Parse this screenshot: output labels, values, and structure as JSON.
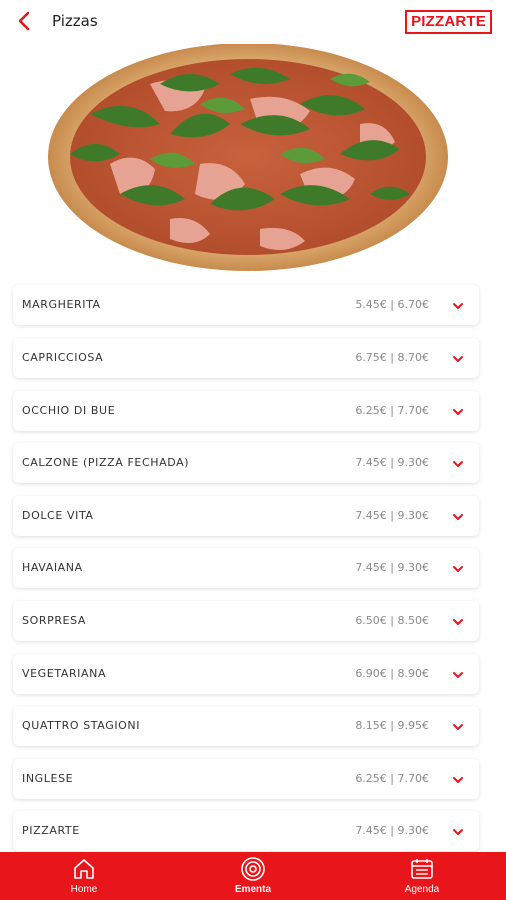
{
  "header": {
    "title": "Pizzas",
    "logo_text": "PIZZARTE",
    "back_icon": "chevron-left-icon"
  },
  "hero": {
    "image": "pizza-photo"
  },
  "menu": [
    {
      "name": "MARGHERITA",
      "price": "5.45€ | 6.70€"
    },
    {
      "name": "CAPRICCIOSA",
      "price": "6.75€ | 8.70€"
    },
    {
      "name": "OCCHIO DI BUE",
      "price": "6.25€ | 7.70€"
    },
    {
      "name": "CALZONE (PIZZA FECHADA)",
      "price": "7.45€ | 9.30€"
    },
    {
      "name": "DOLCE VITA",
      "price": "7.45€ | 9.30€"
    },
    {
      "name": "HAVAIANA",
      "price": "7.45€ | 9.30€"
    },
    {
      "name": "SORPRESA",
      "price": "6.50€ | 8.50€"
    },
    {
      "name": "VEGETARIANA",
      "price": "6.90€ | 8.90€"
    },
    {
      "name": "QUATTRO STAGIONI",
      "price": "8.15€ | 9.95€"
    },
    {
      "name": "INGLESE",
      "price": "6.25€ | 7.70€"
    },
    {
      "name": "PIZZARTE",
      "price": "7.45€ | 9.30€"
    }
  ],
  "bottom_nav": [
    {
      "label": "Home",
      "icon": "home-icon"
    },
    {
      "label": "Ementa",
      "icon": "menu-target-icon"
    },
    {
      "label": "Agenda",
      "icon": "calendar-icon"
    }
  ],
  "colors": {
    "accent": "#e8151b",
    "price": "#8a8a8a",
    "text": "#333333"
  }
}
